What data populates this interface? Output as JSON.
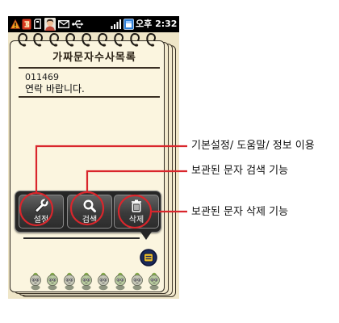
{
  "status_bar": {
    "icons_left": [
      "warning-icon",
      "app-notification-icon",
      "sd-card-icon",
      "contact-avatar-icon",
      "mail-icon",
      "usb-icon"
    ],
    "icons_right": [
      "signal-icon",
      "battery-icon"
    ],
    "time": "오후 2:32"
  },
  "app": {
    "title": "가짜문자수사목록",
    "messages": [
      {
        "number": "011469",
        "text": "연락 바랍니다."
      }
    ]
  },
  "menu": {
    "items": [
      {
        "label": "설정",
        "icon": "wrench-icon"
      },
      {
        "label": "검색",
        "icon": "search-icon"
      },
      {
        "label": "삭제",
        "icon": "trash-icon"
      }
    ],
    "menu_button_icon": "menu-icon"
  },
  "annotations": [
    "기본설정/ 도움말/ 정보 이용",
    "보관된 문자 검색 기능",
    "보관된 문자 삭제 기능"
  ],
  "colors": {
    "annotation": "#d9262c",
    "paper": "#fbf5df",
    "menu_bg": "#262626"
  }
}
